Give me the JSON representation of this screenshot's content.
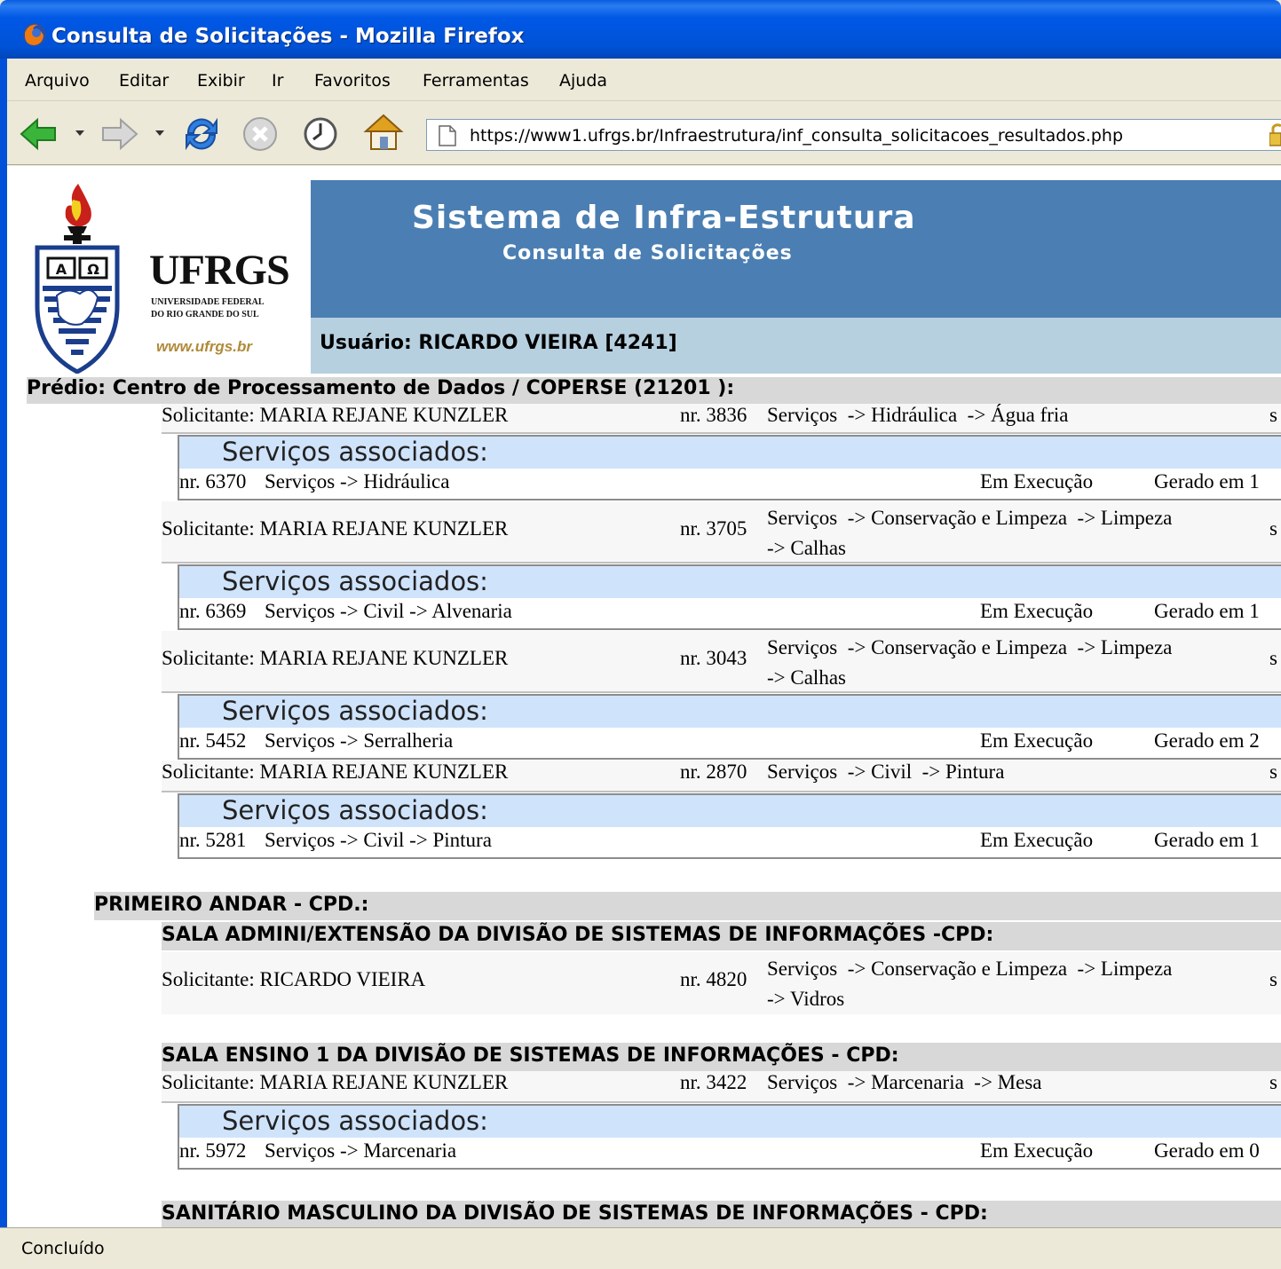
{
  "window": {
    "title": "Consulta de Solicitações - Mozilla Firefox"
  },
  "menu": [
    "Arquivo",
    "Editar",
    "Exibir",
    "Ir",
    "Favoritos",
    "Ferramentas",
    "Ajuda"
  ],
  "toolbar": {
    "url": "https://www1.ufrgs.br/Infraestrutura/inf_consulta_solicitacoes_resultados.php"
  },
  "header": {
    "logo_name": "UFRGS",
    "logo_line1": "UNIVERSIDADE FEDERAL",
    "logo_line2": "DO RIO GRANDE DO SUL",
    "logo_url": "www.ufrgs.br",
    "system_title": "Sistema de Infra-Estrutura",
    "system_subtitle": "Consulta de Solicitações",
    "user": "Usuário: RICARDO VIEIRA [4241]"
  },
  "predio": "Prédio: Centro de Processamento de Dados / COPERSE (21201 ):",
  "assoc_title": "Serviços associados:",
  "requests": [
    {
      "solicitante": "Solicitante: MARIA REJANE KUNZLER",
      "nr": "nr. 3836",
      "servico": "Serviços  -> Hidráulica  -> Água fria",
      "trail": "s",
      "assoc": {
        "nr": "nr. 6370",
        "servico": "Serviços  -> Hidráulica",
        "status": "Em Execução",
        "gerado": "Gerado em 1"
      }
    },
    {
      "solicitante": "Solicitante: MARIA REJANE KUNZLER",
      "nr": "nr. 3705",
      "servico": "Serviços  -> Conservação e Limpeza  -> Limpeza\n-> Calhas",
      "trail": "s",
      "assoc": {
        "nr": "nr. 6369",
        "servico": "Serviços  -> Civil  -> Alvenaria",
        "status": "Em Execução",
        "gerado": "Gerado em 1"
      }
    },
    {
      "solicitante": "Solicitante: MARIA REJANE KUNZLER",
      "nr": "nr. 3043",
      "servico": "Serviços  -> Conservação e Limpeza  -> Limpeza\n-> Calhas",
      "trail": "s",
      "assoc": {
        "nr": "nr. 5452",
        "servico": "Serviços  -> Serralheria",
        "status": "Em Execução",
        "gerado": "Gerado em 2"
      }
    },
    {
      "solicitante": "Solicitante: MARIA REJANE KUNZLER",
      "nr": "nr. 2870",
      "servico": "Serviços  -> Civil  -> Pintura",
      "trail": "s",
      "assoc": {
        "nr": "nr. 5281",
        "servico": "Serviços  -> Civil  -> Pintura",
        "status": "Em Execução",
        "gerado": "Gerado em 1"
      }
    }
  ],
  "floor1": {
    "title": "PRIMEIRO ANDAR - CPD.:",
    "room1": {
      "title": "SALA ADMINI/EXTENSÃO DA DIVISÃO DE SISTEMAS DE INFORMAÇÕES -CPD:",
      "solicitante": "Solicitante: RICARDO VIEIRA",
      "nr": "nr. 4820",
      "servico": "Serviços  -> Conservação e Limpeza  -> Limpeza\n-> Vidros",
      "trail": "s"
    },
    "room2": {
      "title": "SALA ENSINO 1 DA DIVISÃO DE SISTEMAS DE INFORMAÇÕES - CPD:",
      "solicitante": "Solicitante: MARIA REJANE KUNZLER",
      "nr": "nr. 3422",
      "servico": "Serviços  -> Marcenaria  -> Mesa",
      "trail": "s",
      "assoc": {
        "nr": "nr. 5972",
        "servico": "Serviços  -> Marcenaria",
        "status": "Em Execução",
        "gerado": "Gerado em 0"
      }
    },
    "room3": {
      "title": "SANITÁRIO MASCULINO DA DIVISÃO DE SISTEMAS DE INFORMAÇÕES - CPD:"
    }
  },
  "status": "Concluído"
}
